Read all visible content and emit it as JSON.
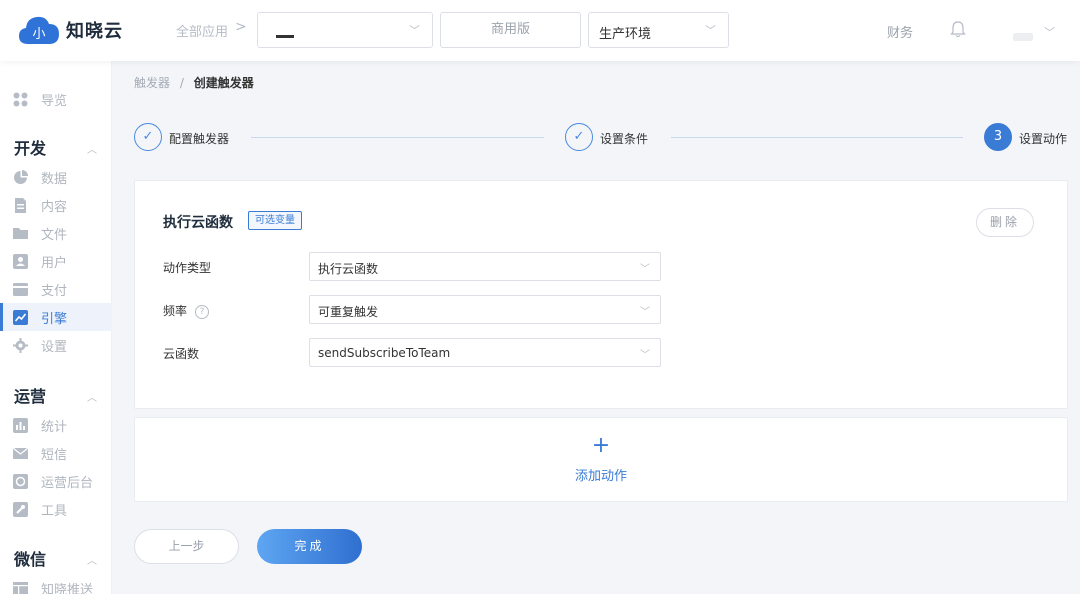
{
  "header": {
    "logo_text": "知晓云",
    "all_apps": "全部应用",
    "crumb_arrow": ">",
    "app_select_value": "",
    "edition": "商用版",
    "env_select_value": "生产环境",
    "finance": "财务"
  },
  "sidebar": {
    "overview": "导览",
    "sections": [
      {
        "title": "开发",
        "items": [
          "数据",
          "内容",
          "文件",
          "用户",
          "支付",
          "引擎",
          "设置"
        ]
      },
      {
        "title": "运营",
        "items": [
          "统计",
          "短信",
          "运营后台",
          "工具"
        ]
      },
      {
        "title": "微信",
        "items": [
          "知晓推送"
        ]
      }
    ],
    "active_item": "引擎"
  },
  "breadcrumb": {
    "parent": "触发器",
    "separator": "/",
    "current": "创建触发器"
  },
  "steps": [
    {
      "label": "配置触发器",
      "state": "done",
      "mark": "✓"
    },
    {
      "label": "设置条件",
      "state": "done",
      "mark": "✓"
    },
    {
      "label": "设置动作",
      "state": "active",
      "mark": "3"
    }
  ],
  "action_card": {
    "title": "执行云函数",
    "tag": "可选变量",
    "delete_label": "删除",
    "fields": [
      {
        "label": "动作类型",
        "value": "执行云函数",
        "help": false
      },
      {
        "label": "频率",
        "value": "可重复触发",
        "help": true
      },
      {
        "label": "云函数",
        "value": "sendSubscribeToTeam",
        "help": false
      }
    ]
  },
  "add_action": {
    "plus": "+",
    "label": "添加动作"
  },
  "footer": {
    "prev_label": "上一步",
    "done_label": "完成"
  },
  "colors": {
    "accent": "#3a7bd5",
    "background": "#f3f5f9"
  }
}
